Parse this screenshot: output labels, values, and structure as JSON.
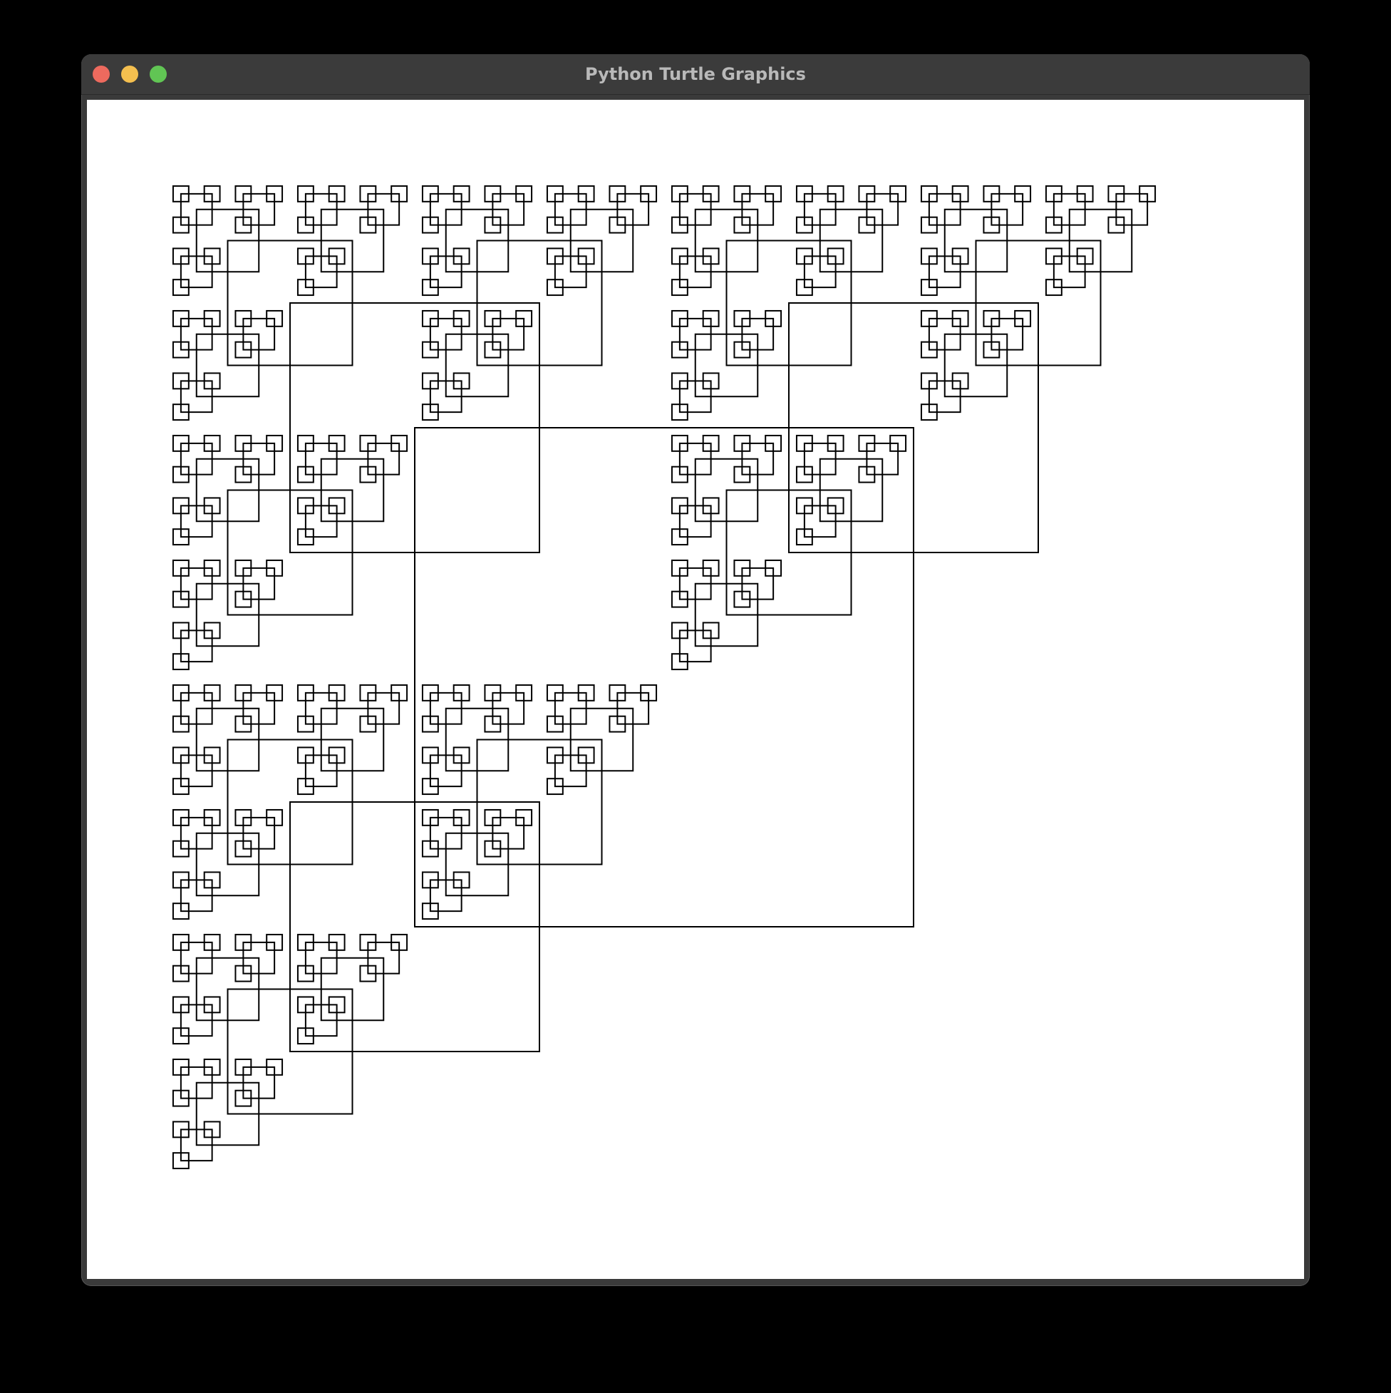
{
  "window": {
    "title": "Python Turtle Graphics",
    "controls": {
      "close_color": "#ed6a5e",
      "minimize_color": "#f4bf4f",
      "maximize_color": "#61c554"
    }
  },
  "canvas": {
    "background": "#ffffff",
    "stroke_color": "#000000",
    "figure": "recursive-square-fractal",
    "recursion_depth": 5
  }
}
